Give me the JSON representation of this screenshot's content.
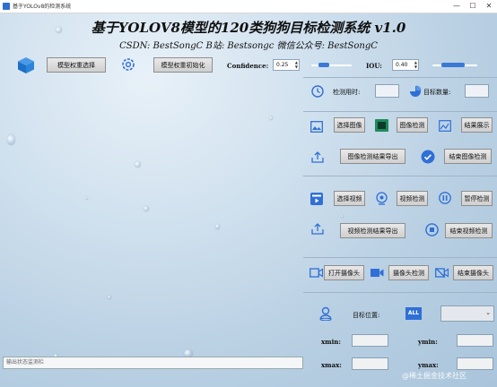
{
  "window": {
    "title": "基于YOLOv8的检测系统",
    "min": "—",
    "max": "☐",
    "close": "✕"
  },
  "header": {
    "title": "基于YOLOV8模型的120类狗狗目标检测系统 v1.0",
    "subtitle": "CSDN:  BestSongC    B站:  Bestsongc    微信公众号:  BestSongC"
  },
  "toolbar": {
    "model_select": "模型权重选择",
    "model_init": "模型权重初始化",
    "confidence_label": "Confidence:",
    "confidence_value": "0.25",
    "iou_label": "IOU:",
    "iou_value": "0.40"
  },
  "sliders": {
    "confidence": 0.25,
    "iou": 0.4
  },
  "stats": {
    "time_label": "检测用时:",
    "time_value": "",
    "count_label": "目标数量:",
    "count_value": ""
  },
  "image_section": {
    "select": "选择图像",
    "detect": "图像检测",
    "show": "结果展示",
    "export": "图像检测结果导出",
    "stop": "结束图像检测"
  },
  "video_section": {
    "select": "选择视频",
    "detect": "视频检测",
    "pause": "暂停检测",
    "export": "视频检测结果导出",
    "stop": "结束视频检测"
  },
  "camera_section": {
    "open": "打开摄像头",
    "detect": "摄像头检测",
    "stop": "结束摄像头"
  },
  "target": {
    "position_label": "目标位置:",
    "all_label": "ALL",
    "xmin": "xmin:",
    "ymin": "ymin:",
    "xmax": "xmax:",
    "ymax": "ymax:"
  },
  "status": {
    "placeholder": "输出状态监测栏"
  },
  "watermark": "@稀土掘金技术社区",
  "colors": {
    "accent": "#2f6fd6",
    "title_text": "#101010"
  }
}
